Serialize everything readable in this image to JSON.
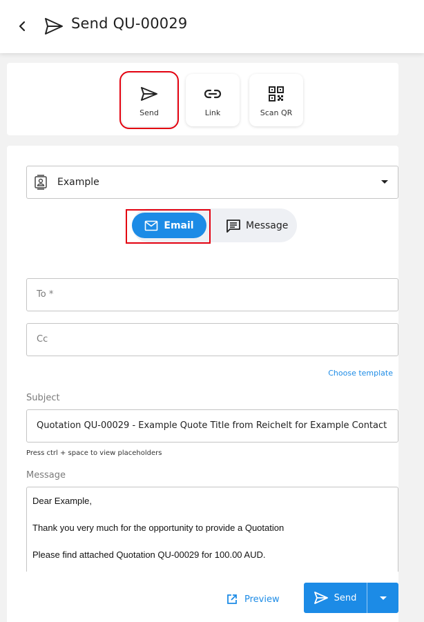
{
  "header": {
    "title": "Send QU-00029",
    "back_icon": "chevron-left-icon",
    "title_icon": "send-icon"
  },
  "share_options": [
    {
      "label": "Send",
      "icon": "send-icon",
      "selected": true
    },
    {
      "label": "Link",
      "icon": "link-icon",
      "selected": false
    },
    {
      "label": "Scan QR",
      "icon": "qr-code-icon",
      "selected": false
    }
  ],
  "contact": {
    "value": "Example",
    "icon": "contact-card-icon"
  },
  "channel_toggle": {
    "email_label": "Email",
    "message_label": "Message",
    "active": "Email"
  },
  "fields": {
    "to_placeholder": "To *",
    "cc_placeholder": "Cc"
  },
  "choose_template_label": "Choose template",
  "subject": {
    "label": "Subject",
    "value": "Quotation QU-00029 - Example Quote Title from Reichelt for Example Contact"
  },
  "placeholder_hint": "Press ctrl + space to view placeholders",
  "message": {
    "label": "Message",
    "lines": [
      "Dear Example,",
      "Thank you very much for the opportunity to provide a Quotation",
      "Please find attached Quotation QU-00029 for 100.00 AUD."
    ]
  },
  "actions": {
    "preview_label": "Preview",
    "send_label": "Send"
  },
  "colors": {
    "accent": "#1c8be6",
    "highlight": "#e3000f"
  }
}
